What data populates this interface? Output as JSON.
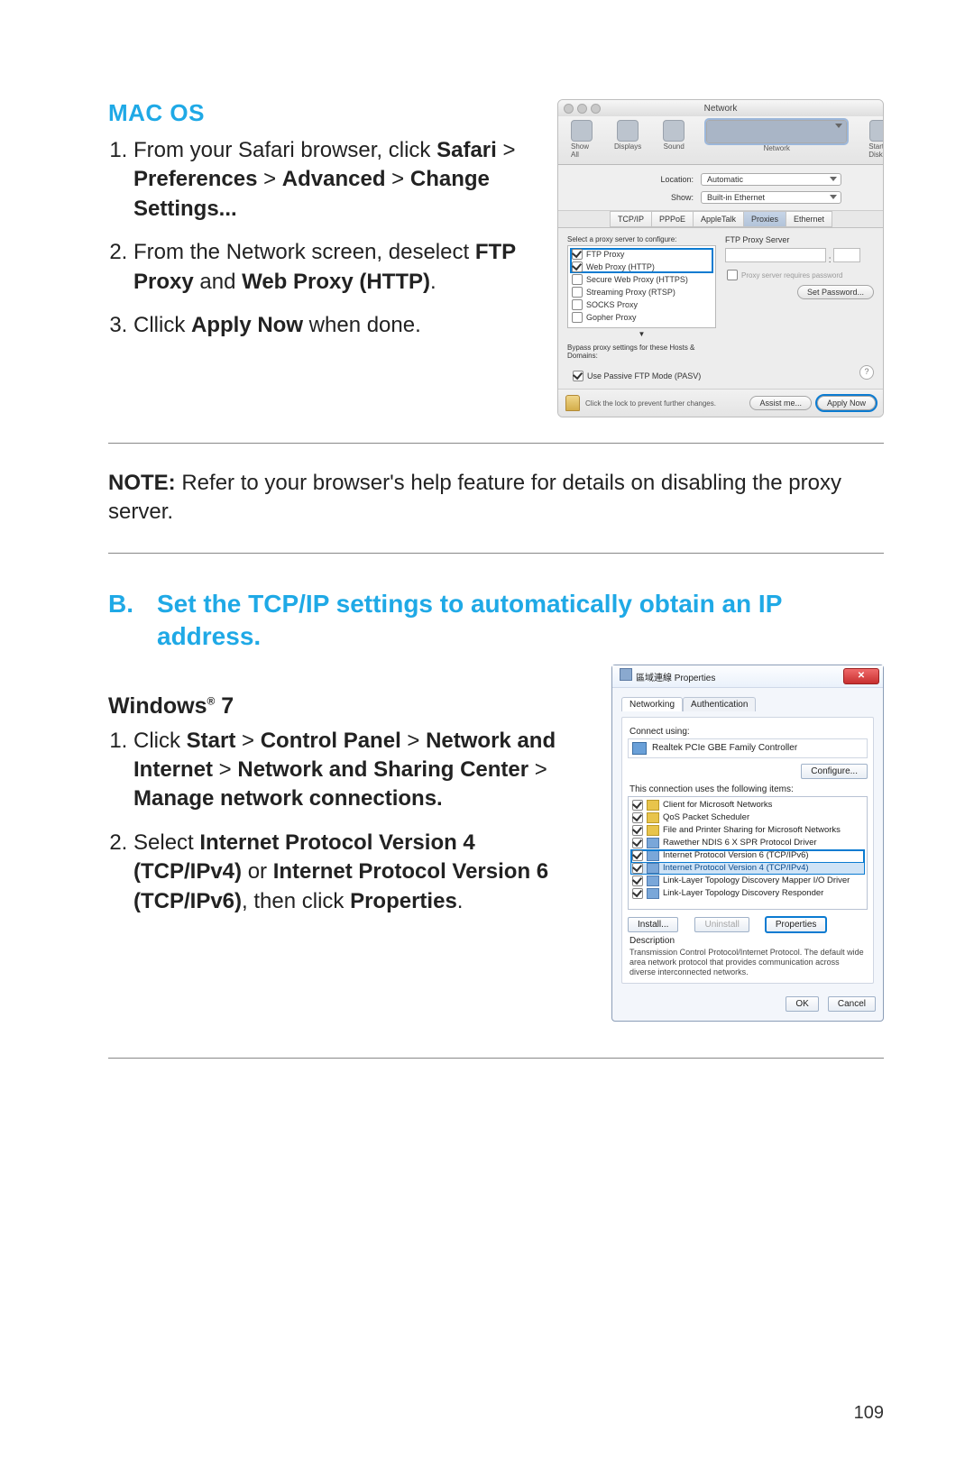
{
  "page_number": "109",
  "macos": {
    "heading": "MAC OS",
    "steps": {
      "s1a": "From your Safari browser, click ",
      "s1b": "Safari",
      "s1c": " > ",
      "s1d": "Preferences",
      "s1e": " > ",
      "s1f": "Advanced",
      "s1g": " > ",
      "s1h": "Change Settings...",
      "s2a": "From the Network screen, deselect ",
      "s2b": "FTP Proxy",
      "s2c": " and ",
      "s2d": "Web Proxy (HTTP)",
      "s2e": ".",
      "s3a": "Cllick ",
      "s3b": "Apply Now",
      "s3c": " when done."
    }
  },
  "note": {
    "label": "NOTE:",
    "text": " Refer to your browser's help feature for details on disabling the proxy server."
  },
  "sectionB": {
    "letter": "B.",
    "title": "Set the TCP/IP settings to automatically obtain an IP address."
  },
  "windows": {
    "heading_main": "Windows",
    "heading_reg": "®",
    "heading_ver": " 7",
    "steps": {
      "s1a": "Click ",
      "s1b": "Start",
      "s1c": " > ",
      "s1d": "Control Panel",
      "s1e": " > ",
      "s1f": "Network and Internet",
      "s1g": " > ",
      "s1h": "Network and Sharing Center",
      "s1i": " > ",
      "s1j": "Manage network connections.",
      "s2a": "Select ",
      "s2b": "Internet Protocol Version 4 (TCP/IPv4)",
      "s2c": " or ",
      "s2d": "Internet Protocol Version 6 (TCP/IPv6)",
      "s2e": ", then click ",
      "s2f": "Properties",
      "s2g": "."
    }
  },
  "mac_shot": {
    "title": "Network",
    "tb": {
      "showall": "Show All",
      "displays": "Displays",
      "sound": "Sound",
      "network": "Network",
      "startup": "Startup Disk"
    },
    "loc_lbl": "Location:",
    "loc_val": "Automatic",
    "show_lbl": "Show:",
    "show_val": "Built-in Ethernet",
    "tabs": {
      "tcpip": "TCP/IP",
      "pppoe": "PPPoE",
      "atalk": "AppleTalk",
      "proxies": "Proxies",
      "eth": "Ethernet"
    },
    "select_label": "Select a proxy server to configure:",
    "items": {
      "ftp": "FTP Proxy",
      "web": "Web Proxy (HTTP)",
      "sweb": "Secure Web Proxy (HTTPS)",
      "stream": "Streaming Proxy (RTSP)",
      "socks": "SOCKS Proxy",
      "gopher": "Gopher Proxy"
    },
    "ftp_title": "FTP Proxy Server",
    "pwd": "Proxy server requires password",
    "setpwd": "Set Password...",
    "bypass": "Bypass proxy settings for these Hosts & Domains:",
    "pasv": "Use Passive FTP Mode (PASV)",
    "lock": "Click the lock to prevent further changes.",
    "assist": "Assist me...",
    "apply": "Apply Now",
    "help": "?"
  },
  "win_shot": {
    "title": "區域連線 Properties",
    "tabs": {
      "net": "Networking",
      "auth": "Authentication"
    },
    "connect": "Connect using:",
    "adapter": "Realtek PCIe GBE Family Controller",
    "configure": "Configure...",
    "uses": "This connection uses the following items:",
    "items": {
      "client": "Client for Microsoft Networks",
      "qos": "QoS Packet Scheduler",
      "fps": "File and Printer Sharing for Microsoft Networks",
      "raw": "Rawether NDIS 6 X SPR Protocol Driver",
      "v6": "Internet Protocol Version 6 (TCP/IPv6)",
      "v4": "Internet Protocol Version 4 (TCP/IPv4)",
      "lltm": "Link-Layer Topology Discovery Mapper I/O Driver",
      "lltr": "Link-Layer Topology Discovery Responder"
    },
    "install": "Install...",
    "uninstall": "Uninstall",
    "properties": "Properties",
    "desc_lbl": "Description",
    "desc": "Transmission Control Protocol/Internet Protocol. The default wide area network protocol that provides communication across diverse interconnected networks.",
    "ok": "OK",
    "cancel": "Cancel"
  }
}
